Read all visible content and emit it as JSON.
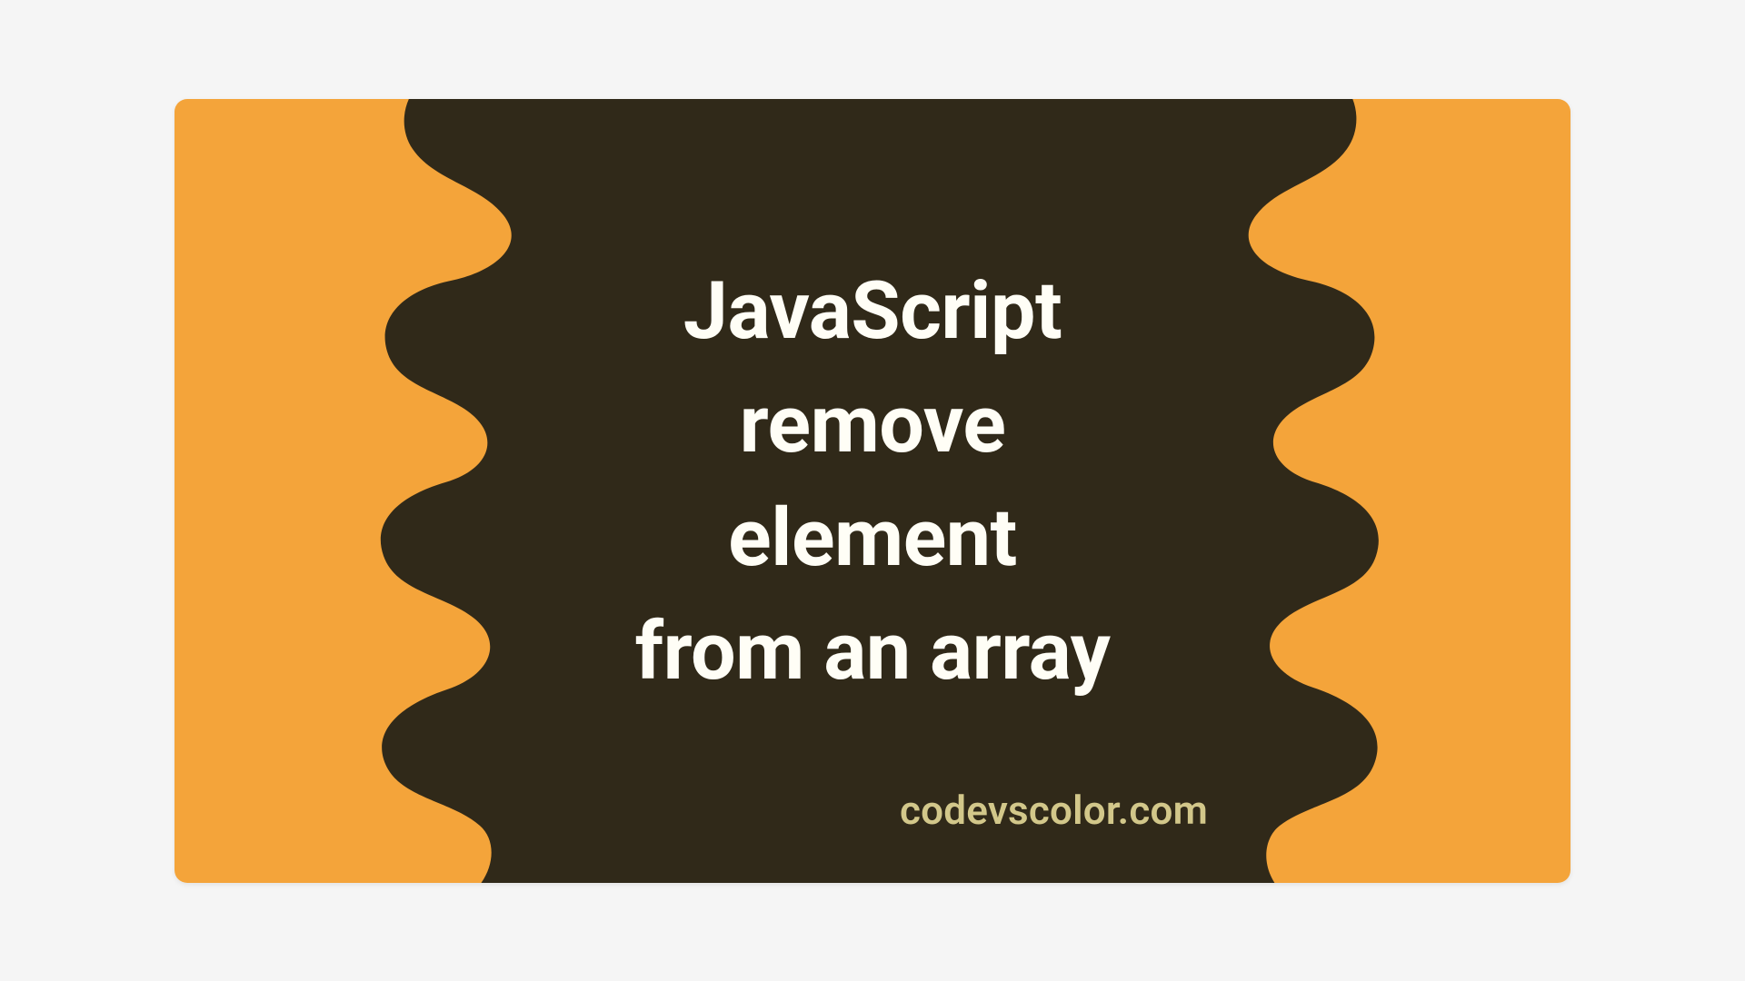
{
  "colors": {
    "orange": "#f4a43a",
    "dark": "#302919",
    "text": "#fffef6",
    "footer": "#d2c78a"
  },
  "title": {
    "line1": "JavaScript",
    "line2": "remove",
    "line3": "element",
    "line4": "from an array"
  },
  "footer": {
    "site": "codevscolor.com"
  }
}
